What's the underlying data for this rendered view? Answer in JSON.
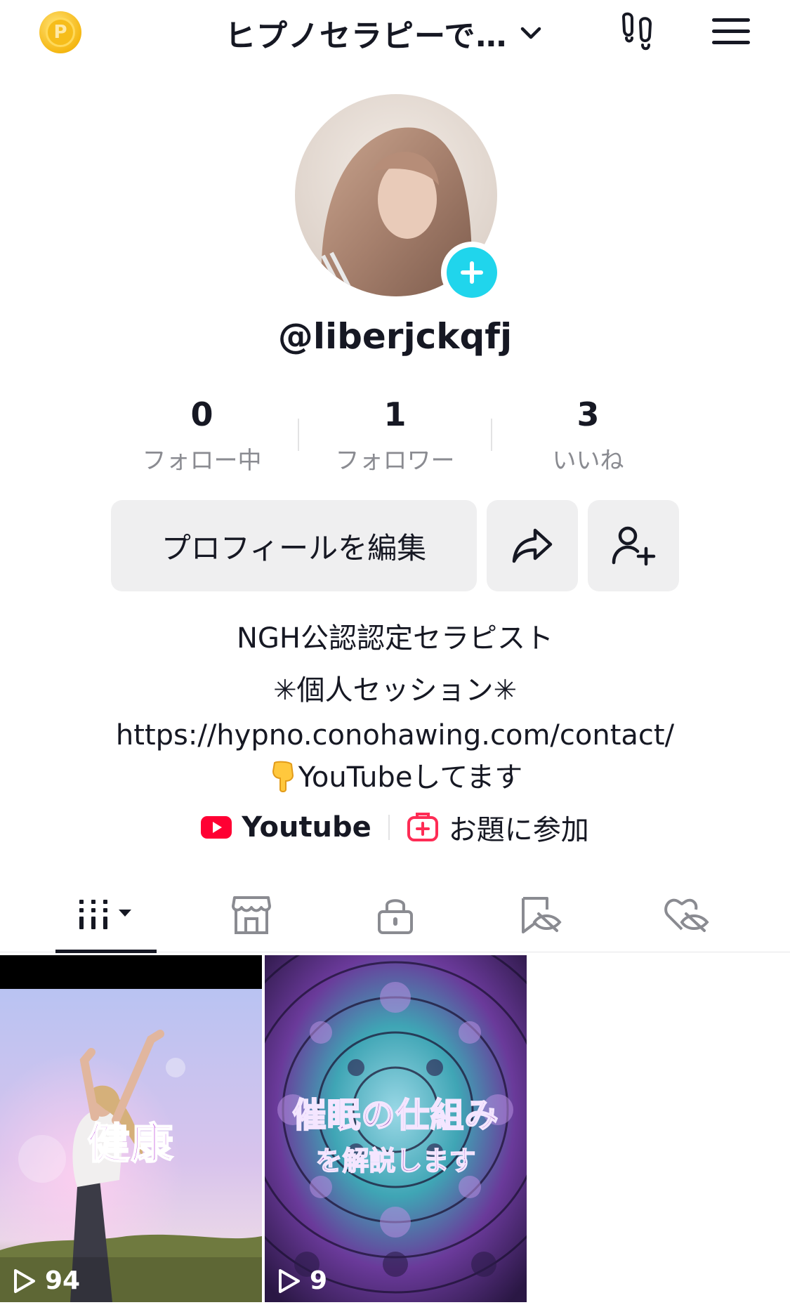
{
  "header": {
    "account_name": "ヒプノセラピーで…",
    "icons": {
      "coin": "coin-icon",
      "chevron": "chevron-down-icon",
      "footprint": "footprint-icon",
      "menu": "hamburger-menu-icon"
    }
  },
  "profile": {
    "username": "@liberjckqfj",
    "avatar_add_icon": "plus-icon"
  },
  "stats": [
    {
      "value": "0",
      "label": "フォロー中"
    },
    {
      "value": "1",
      "label": "フォロワー"
    },
    {
      "value": "3",
      "label": "いいね"
    }
  ],
  "actions": {
    "edit_profile": "プロフィールを編集",
    "share_icon": "share-icon",
    "add_friend_icon": "add-friend-icon"
  },
  "bio": {
    "line1": "NGH公認認定セラピスト",
    "line2": "✳︎個人セッション✳︎",
    "line3": "https://hypno.conohawing.com/contact/",
    "line4": "YouTubeしてます"
  },
  "links": {
    "youtube_label": "Youtube",
    "topic_label": "お題に参加"
  },
  "tabs": [
    {
      "name": "videos",
      "icon": "grid-icon",
      "active": true
    },
    {
      "name": "shop",
      "icon": "shop-icon",
      "active": false
    },
    {
      "name": "private",
      "icon": "lock-icon",
      "active": false
    },
    {
      "name": "favorites",
      "icon": "bookmark-hidden-icon",
      "active": false
    },
    {
      "name": "liked",
      "icon": "heart-hidden-icon",
      "active": false
    }
  ],
  "videos": [
    {
      "caption": "健康",
      "views": "94"
    },
    {
      "caption_line1": "催眠の仕組み",
      "caption_line2": "を解説します",
      "views": "9"
    }
  ],
  "colors": {
    "accent_cyan": "#20d5ec",
    "youtube_red": "#ff0033",
    "topic_pink": "#fe2c55",
    "button_bg": "#efeff0",
    "muted_text": "#8a8b91"
  }
}
